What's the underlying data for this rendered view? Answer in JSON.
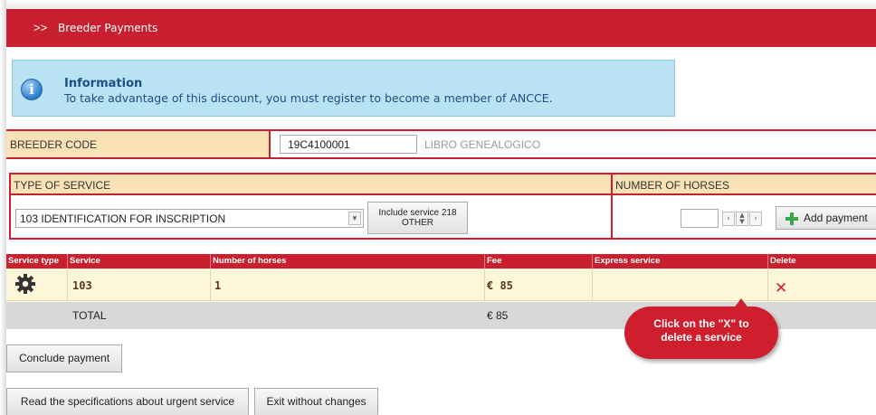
{
  "header": {
    "breadcrumb_arrows": ">>",
    "breadcrumb_title": "Breeder Payments"
  },
  "info": {
    "icon": "info-icon",
    "title": "Information",
    "message": "To take advantage of this discount, you must register to become a member of ANCCE."
  },
  "breeder": {
    "label": "BREEDER CODE",
    "code_value": "19C4100001",
    "book_name": "LIBRO GENEALOGICO"
  },
  "service_form": {
    "type_header": "TYPE OF SERVICE",
    "number_header": "NUMBER OF HORSES",
    "selected_service": "103 IDENTIFICATION FOR INSCRIPTION",
    "include_line1": "Include service 218",
    "include_line2": "OTHER",
    "number_value": "",
    "add_label": "Add payment"
  },
  "grid": {
    "columns": [
      "Service type",
      "Service",
      "Number of horses",
      "Fee",
      "Express service",
      "Delete"
    ],
    "rows": [
      {
        "icon": "gear-icon",
        "service": "103",
        "horses": "1",
        "fee": "€ 85",
        "express": "",
        "delete": "✕"
      }
    ],
    "total_label": "TOTAL",
    "total_value": "€ 85"
  },
  "tooltip": {
    "line1": "Click on the \"X\" to",
    "line2": "delete a service"
  },
  "buttons": {
    "conclude": "Conclude payment",
    "specs": "Read the specifications about urgent service",
    "exit": "Exit without changes"
  },
  "colors": {
    "brand_red": "#c8202f",
    "header_beige": "#fbe2b6",
    "info_blue": "#b9e2f3",
    "row_cream": "#fdf6d8"
  }
}
